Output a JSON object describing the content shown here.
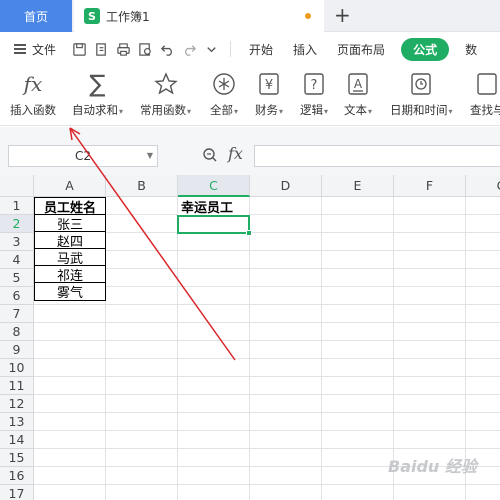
{
  "tabs": {
    "home": "首页",
    "doc_icon": "S",
    "doc_title": "工作簿1",
    "new_tab": "+"
  },
  "menu": {
    "file": "文件",
    "items": [
      "开始",
      "插入",
      "页面布局"
    ],
    "active": "公式",
    "overflow": "数"
  },
  "ribbon": [
    {
      "label": "插入函数",
      "icon": "fx-icon"
    },
    {
      "label": "自动求和",
      "icon": "sum-icon"
    },
    {
      "label": "常用函数",
      "icon": "star-icon"
    },
    {
      "label": "全部",
      "icon": "asterisk-icon"
    },
    {
      "label": "财务",
      "icon": "yen-icon"
    },
    {
      "label": "逻辑",
      "icon": "question-icon"
    },
    {
      "label": "文本",
      "icon": "text-a-icon"
    },
    {
      "label": "日期和时间",
      "icon": "clock-icon"
    },
    {
      "label": "查找与",
      "icon": "lookup-icon"
    }
  ],
  "formula_bar": {
    "name_box": "C2",
    "fx": "fx",
    "formula": ""
  },
  "columns": [
    "A",
    "B",
    "C",
    "D",
    "E",
    "F",
    "G"
  ],
  "active_column": "C",
  "rows": [
    "1",
    "2",
    "3",
    "4",
    "5",
    "6",
    "7",
    "8",
    "9",
    "10",
    "11",
    "12",
    "13",
    "14",
    "15",
    "16",
    "17"
  ],
  "active_row": "2",
  "cells": {
    "A1": "员工姓名",
    "A2": "张三",
    "A3": "赵四",
    "A4": "马武",
    "A5": "祁连",
    "A6": "雾气",
    "C1": "幸运员工"
  },
  "watermark": "Baidu 经验",
  "colors": {
    "accent": "#1fad63",
    "home_tab": "#4a86e8",
    "annotation": "#d9262a"
  }
}
